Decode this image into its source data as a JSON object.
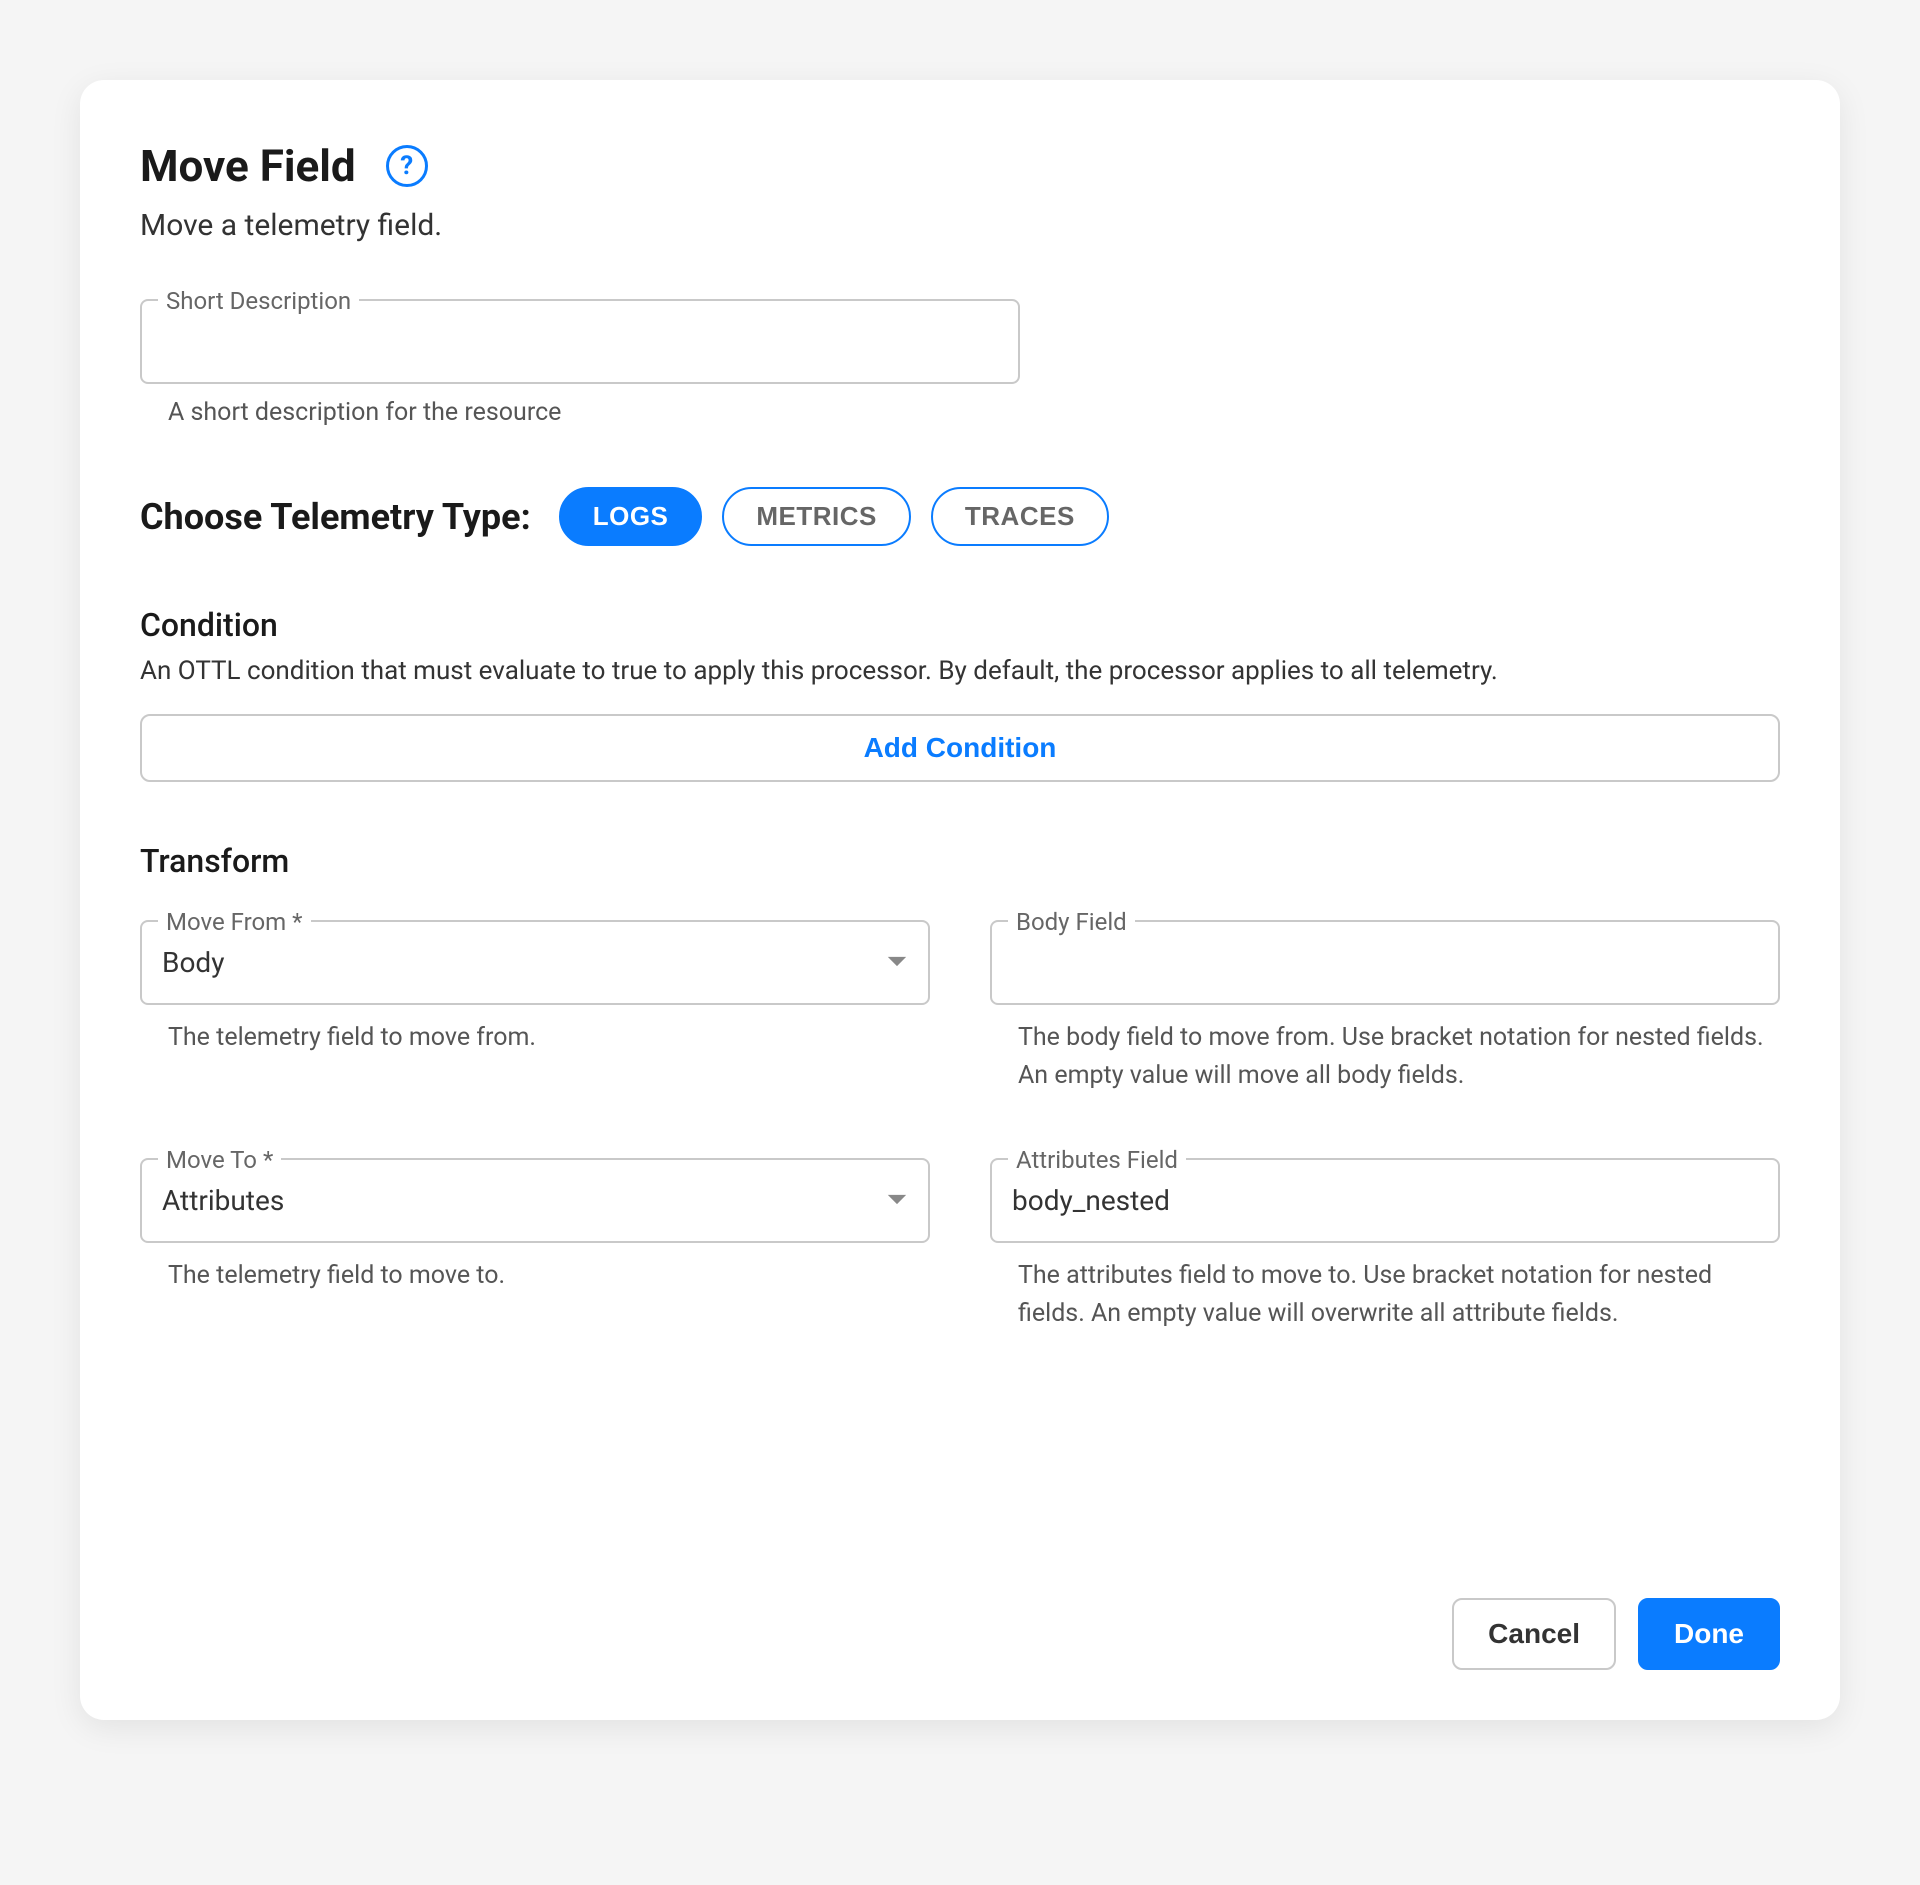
{
  "header": {
    "title": "Move Field",
    "subtitle": "Move a telemetry field."
  },
  "short_description": {
    "label": "Short Description",
    "value": "",
    "helper": "A short description for the resource"
  },
  "telemetry": {
    "label": "Choose Telemetry Type:",
    "options": [
      "LOGS",
      "METRICS",
      "TRACES"
    ],
    "selected": "LOGS"
  },
  "condition": {
    "title": "Condition",
    "description": "An OTTL condition that must evaluate to true to apply this processor. By default, the processor applies to all telemetry.",
    "add_button": "Add Condition"
  },
  "transform": {
    "title": "Transform",
    "move_from": {
      "label": "Move From *",
      "value": "Body",
      "helper": "The telemetry field to move from."
    },
    "body_field": {
      "label": "Body Field",
      "value": "",
      "helper": "The body field to move from. Use bracket notation for nested fields. An empty value will move all body fields."
    },
    "move_to": {
      "label": "Move To *",
      "value": "Attributes",
      "helper": "The telemetry field to move to."
    },
    "attributes_field": {
      "label": "Attributes Field",
      "value": "body_nested",
      "helper": "The attributes field to move to. Use bracket notation for nested fields. An empty value will overwrite all attribute fields."
    }
  },
  "footer": {
    "cancel": "Cancel",
    "done": "Done"
  },
  "colors": {
    "primary": "#0a7cff",
    "border": "#c9c9c9",
    "text": "#1a1a1a",
    "muted": "#666"
  }
}
